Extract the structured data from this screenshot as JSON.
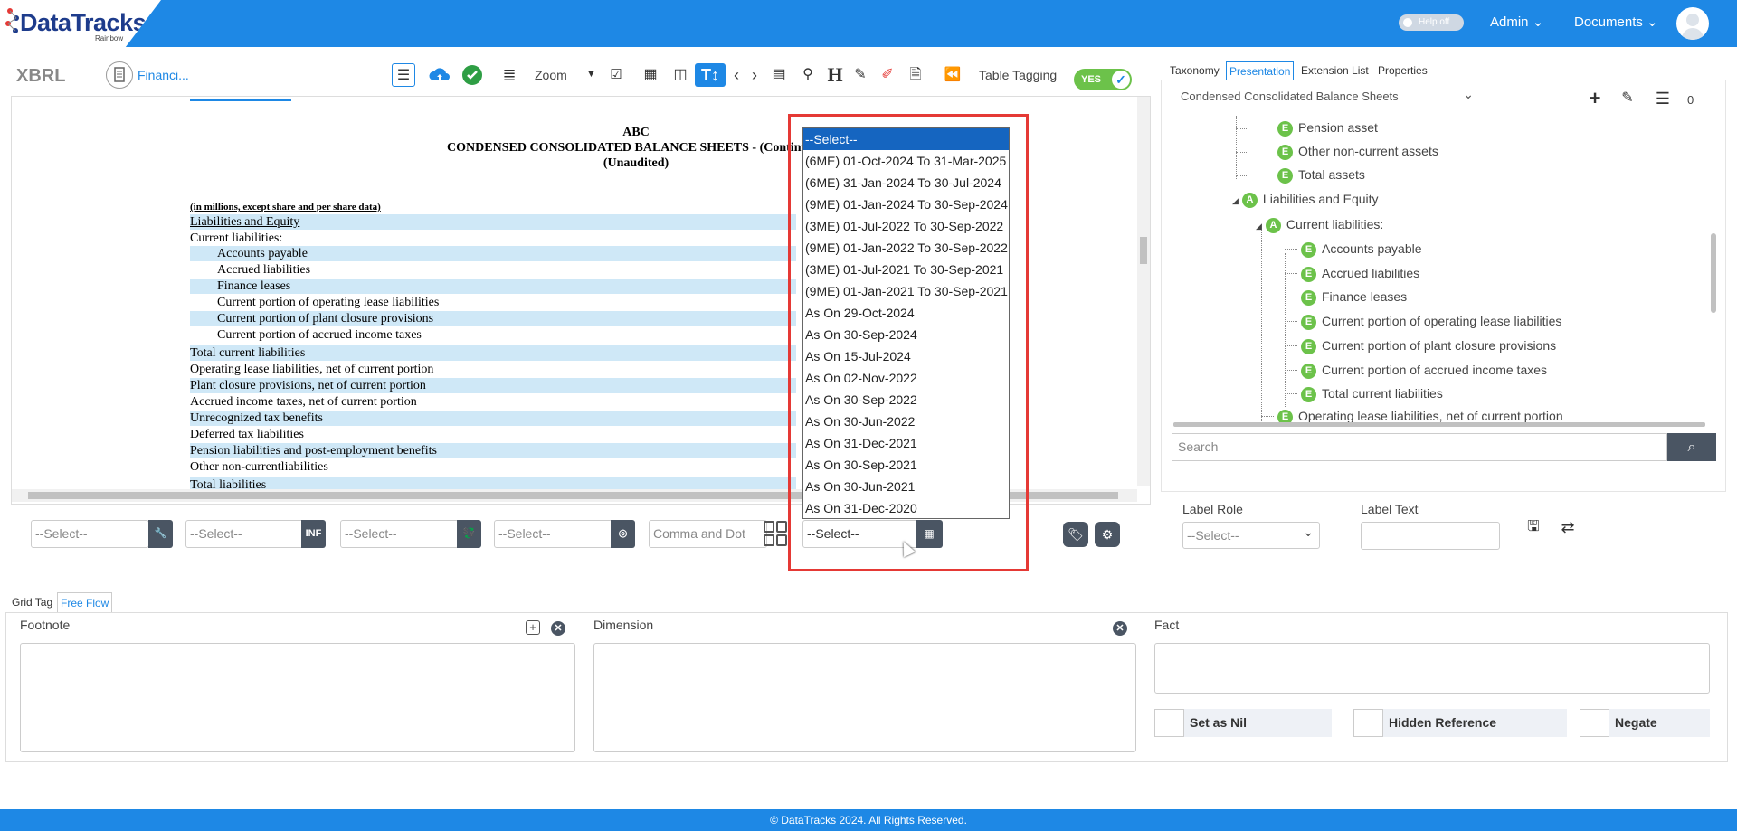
{
  "app": {
    "logo_text": "DataTracks",
    "logo_sub": "Rainbow",
    "help_toggle": "Help off",
    "admin_menu": "Admin",
    "documents_menu": "Documents"
  },
  "toolbar": {
    "title": "XBRL",
    "doc_name": "Financi...",
    "zoom_label": "Zoom",
    "table_tagging_label": "Table Tagging",
    "table_tagging_toggle": "YES"
  },
  "document": {
    "company": "ABC",
    "title": "CONDENSED CONSOLIDATED BALANCE SHEETS - (Continued)",
    "subtitle": "(Unaudited)",
    "note": "(in millions, except share and per share data)",
    "rows": [
      {
        "label": "Liabilities and Equity"
      },
      {
        "label": "Current liabilities:"
      },
      {
        "label": "Accounts payable"
      },
      {
        "label": "Accrued liabilities"
      },
      {
        "label": "Finance leases"
      },
      {
        "label": "Current portion of operating lease liabilities"
      },
      {
        "label": "Current portion of plant closure provisions"
      },
      {
        "label": "Current portion of accrued income taxes"
      },
      {
        "label": "Total current liabilities"
      },
      {
        "label": "Operating lease liabilities, net of current portion"
      },
      {
        "label": "Plant closure provisions, net of current portion"
      },
      {
        "label": "Accrued income taxes, net of current portion"
      },
      {
        "label": "Unrecognized tax benefits"
      },
      {
        "label": "Deferred tax liabilities"
      },
      {
        "label": "Pension liabilities and post-employment benefits"
      },
      {
        "label": "Other non-currentliabilities"
      },
      {
        "label": "Total liabilities"
      }
    ]
  },
  "selectors": {
    "select1": "--Select--",
    "select1_btn": "🔧",
    "select2": "--Select--",
    "select2_btn": "INF",
    "select3": "--Select--",
    "select3_btn": "💱",
    "select4": "--Select--",
    "select4_btn": "◎",
    "separator_placeholder": "Comma and Dot",
    "period_select": "--Select--"
  },
  "period_dropdown": {
    "options": [
      "--Select--",
      "(6ME) 01-Oct-2024 To 31-Mar-2025",
      "(6ME) 31-Jan-2024 To 30-Jul-2024",
      "(9ME) 01-Jan-2024 To 30-Sep-2024",
      "(3ME) 01-Jul-2022 To 30-Sep-2022",
      "(9ME) 01-Jan-2022 To 30-Sep-2022",
      "(3ME) 01-Jul-2021 To 30-Sep-2021",
      "(9ME) 01-Jan-2021 To 30-Sep-2021",
      "As On 29-Oct-2024",
      "As On 30-Sep-2024",
      "As On 15-Jul-2024",
      "As On 02-Nov-2022",
      "As On 30-Sep-2022",
      "As On 30-Jun-2022",
      "As On 31-Dec-2021",
      "As On 30-Sep-2021",
      "As On 30-Jun-2021",
      "As On 31-Dec-2020"
    ]
  },
  "right_panel": {
    "tabs": [
      "Taxonomy",
      "Presentation",
      "Extension List",
      "Properties"
    ],
    "taxonomy_select": "Condensed Consolidated Balance Sheets",
    "count": "0",
    "tree": [
      {
        "badge": "E",
        "label": "Pension asset"
      },
      {
        "badge": "E",
        "label": "Other non-current assets"
      },
      {
        "badge": "E",
        "label": "Total assets"
      },
      {
        "badge": "A",
        "label": "Liabilities and Equity"
      },
      {
        "badge": "A",
        "label": "Current liabilities:"
      },
      {
        "badge": "E",
        "label": "Accounts payable"
      },
      {
        "badge": "E",
        "label": "Accrued liabilities"
      },
      {
        "badge": "E",
        "label": "Finance leases"
      },
      {
        "badge": "E",
        "label": "Current portion of operating lease liabilities"
      },
      {
        "badge": "E",
        "label": "Current portion of plant closure provisions"
      },
      {
        "badge": "E",
        "label": "Current portion of accrued income taxes"
      },
      {
        "badge": "E",
        "label": "Total current liabilities"
      },
      {
        "badge": "E",
        "label": "Operating lease liabilities, net of current portion"
      }
    ],
    "search_placeholder": "Search",
    "label_role_title": "Label Role",
    "label_role_value": "--Select--",
    "label_text_title": "Label Text"
  },
  "bottom": {
    "tabs": [
      "Grid Tag",
      "Free Flow"
    ],
    "footnote_title": "Footnote",
    "dimension_title": "Dimension",
    "fact_title": "Fact",
    "set_as_nil": "Set as Nil",
    "hidden_reference": "Hidden Reference",
    "negate": "Negate"
  },
  "footer": {
    "text": "© DataTracks 2024. All Rights Reserved."
  }
}
